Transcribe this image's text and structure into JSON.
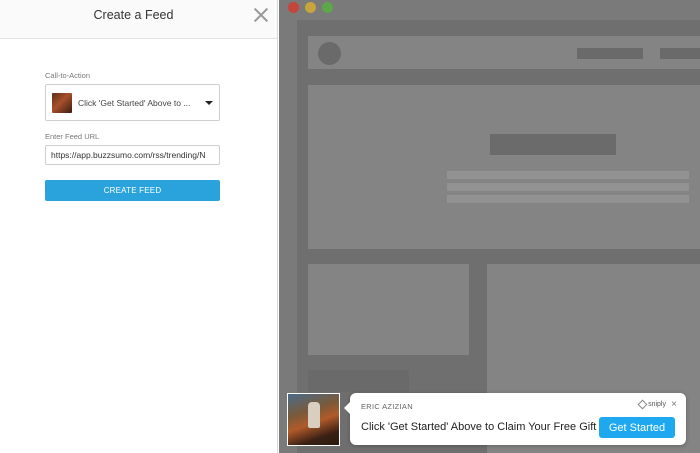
{
  "panel": {
    "title": "Create a Feed",
    "cta_label": "Call-to-Action",
    "cta_selected": "Click 'Get Started' Above to ...",
    "feed_url_label": "Enter Feed URL",
    "feed_url_value": "https://app.buzzsumo.com/rss/trending/N",
    "create_button": "CREATE FEED"
  },
  "preview": {
    "author": "ERIC AZIZIAN",
    "brand": "sniply",
    "message": "Click 'Get Started' Above to Claim Your Free Gift",
    "button": "Get Started",
    "close": "×"
  },
  "colors": {
    "primary": "#2aa3dd",
    "cta_button": "#1ea8f0",
    "browser_red": "#c6453b",
    "browser_yellow": "#c8a43d",
    "browser_green": "#5da64a"
  }
}
